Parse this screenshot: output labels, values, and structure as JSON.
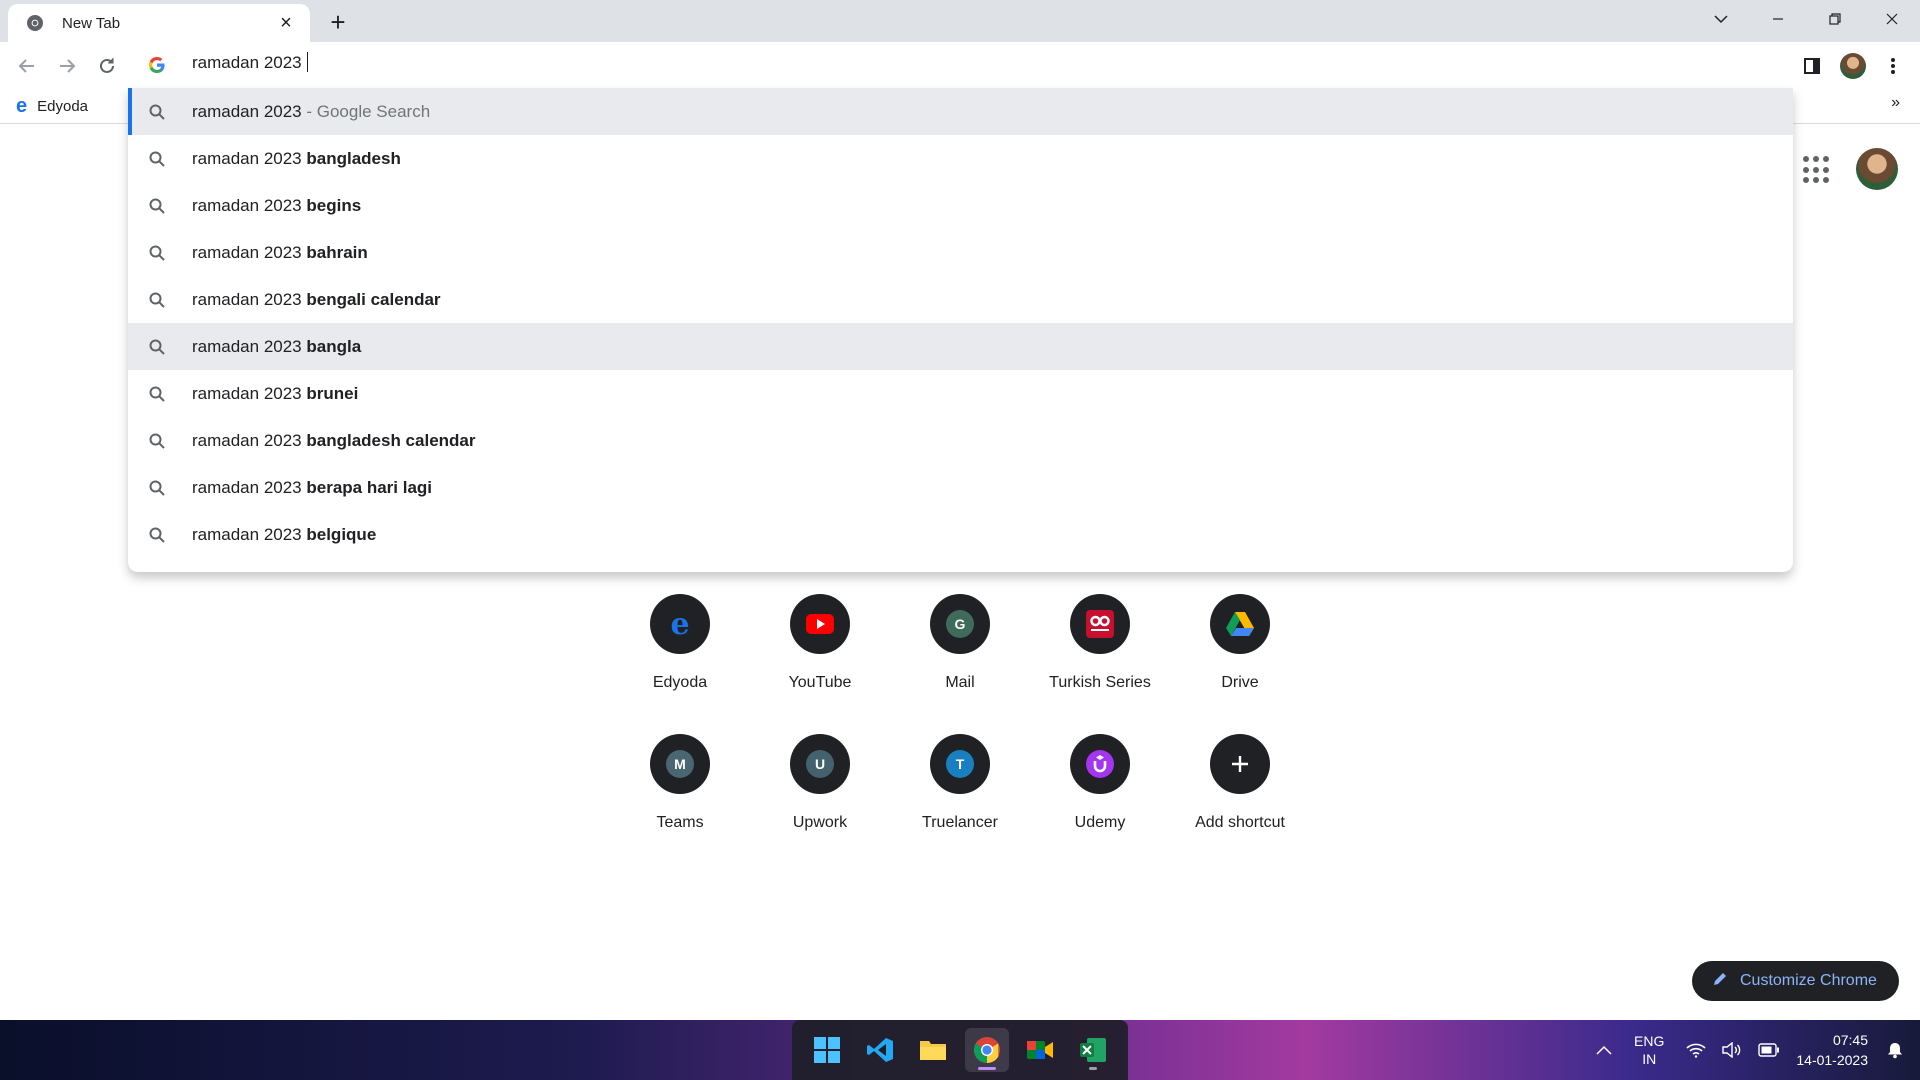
{
  "tab": {
    "title": "New Tab"
  },
  "omnibox": {
    "value": "ramadan 2023"
  },
  "suggestions": [
    {
      "base": "ramadan 2023",
      "bold": "",
      "sub": " - Google Search"
    },
    {
      "base": "ramadan 2023 ",
      "bold": "bangladesh",
      "sub": ""
    },
    {
      "base": "ramadan 2023 ",
      "bold": "begins",
      "sub": ""
    },
    {
      "base": "ramadan 2023 ",
      "bold": "bahrain",
      "sub": ""
    },
    {
      "base": "ramadan 2023 ",
      "bold": "bengali calendar",
      "sub": ""
    },
    {
      "base": "ramadan 2023 ",
      "bold": "bangla",
      "sub": ""
    },
    {
      "base": "ramadan 2023 ",
      "bold": "brunei",
      "sub": ""
    },
    {
      "base": "ramadan 2023 ",
      "bold": "bangladesh calendar",
      "sub": ""
    },
    {
      "base": "ramadan 2023 ",
      "bold": "berapa hari lagi",
      "sub": ""
    },
    {
      "base": "ramadan 2023 ",
      "bold": "belgique",
      "sub": ""
    }
  ],
  "bookmarks": {
    "items": [
      {
        "label": "Edyoda"
      }
    ],
    "overflow": "»"
  },
  "shortcuts": [
    {
      "label": "Edyoda",
      "icon": "edyoda-icon"
    },
    {
      "label": "YouTube",
      "icon": "youtube-icon"
    },
    {
      "label": "Mail",
      "icon": "G"
    },
    {
      "label": "Turkish Series",
      "icon": "turkish-series-icon"
    },
    {
      "label": "Drive",
      "icon": "drive-icon"
    },
    {
      "label": "Teams",
      "icon": "M"
    },
    {
      "label": "Upwork",
      "icon": "U"
    },
    {
      "label": "Truelancer",
      "icon": "T"
    },
    {
      "label": "Udemy",
      "icon": "udemy-icon"
    },
    {
      "label": "Add shortcut",
      "icon": "plus-icon"
    }
  ],
  "customize": {
    "label": "Customize Chrome"
  },
  "tray": {
    "lang_line1": "ENG",
    "lang_line2": "IN",
    "time": "07:45",
    "date": "14-01-2023"
  },
  "colors": {
    "accent": "#1a73e8",
    "highlight": "#e8eaed",
    "shortcut_bg": "#202124",
    "customize_text": "#8ab4f8"
  }
}
